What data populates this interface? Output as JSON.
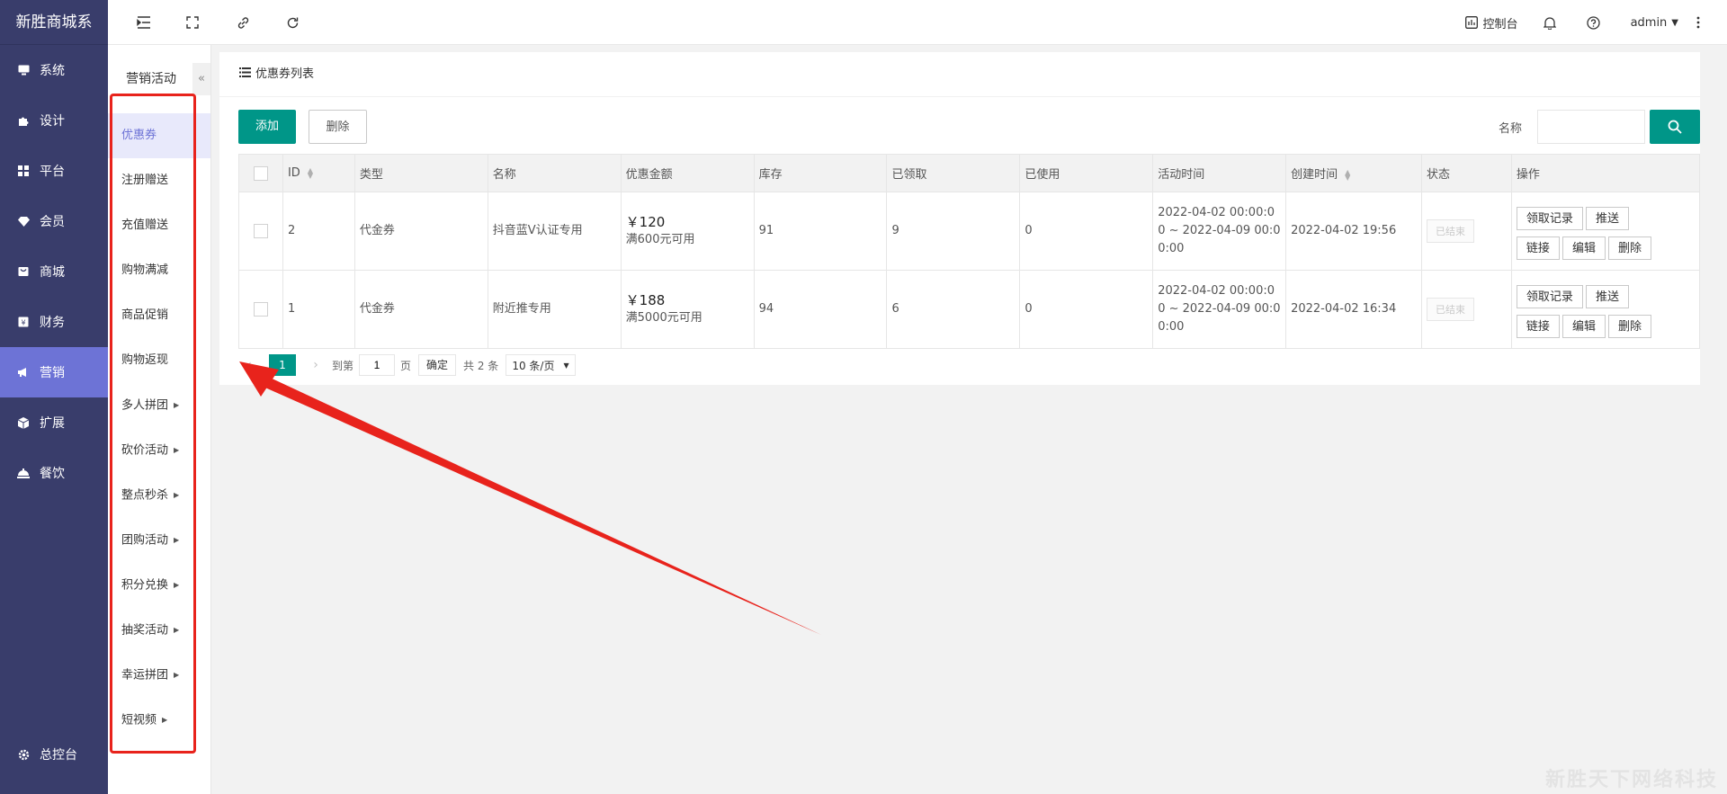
{
  "brand": "新胜商城系",
  "nav": [
    {
      "label": "系统",
      "icon": "monitor-icon"
    },
    {
      "label": "设计",
      "icon": "puzzle-icon"
    },
    {
      "label": "平台",
      "icon": "grid-icon"
    },
    {
      "label": "会员",
      "icon": "diamond-icon"
    },
    {
      "label": "商城",
      "icon": "mall-icon"
    },
    {
      "label": "财务",
      "icon": "wallet-icon"
    },
    {
      "label": "营销",
      "icon": "megaphone-icon",
      "active": true
    },
    {
      "label": "扩展",
      "icon": "cube-icon"
    },
    {
      "label": "餐饮",
      "icon": "dish-icon"
    }
  ],
  "nav_bottom": {
    "label": "总控台",
    "icon": "gear-icon"
  },
  "submenu": {
    "title": "营销活动",
    "collapse": "«",
    "items": [
      {
        "label": "优惠券",
        "active": true
      },
      {
        "label": "注册赠送"
      },
      {
        "label": "充值赠送"
      },
      {
        "label": "购物满减"
      },
      {
        "label": "商品促销"
      },
      {
        "label": "购物返现"
      },
      {
        "label": "多人拼团",
        "expand": true
      },
      {
        "label": "砍价活动",
        "expand": true
      },
      {
        "label": "整点秒杀",
        "expand": true
      },
      {
        "label": "团购活动",
        "expand": true
      },
      {
        "label": "积分兑换",
        "expand": true
      },
      {
        "label": "抽奖活动",
        "expand": true
      },
      {
        "label": "幸运拼团",
        "expand": true
      },
      {
        "label": "短视频",
        "expand": true
      }
    ]
  },
  "header": {
    "console_label": "控制台",
    "user_label": "admin"
  },
  "panel": {
    "title": "优惠券列表",
    "add_label": "添加",
    "delete_label": "删除",
    "search_label": "名称",
    "search_value": ""
  },
  "table": {
    "columns": [
      "ID",
      "类型",
      "名称",
      "优惠金额",
      "库存",
      "已领取",
      "已使用",
      "活动时间",
      "创建时间",
      "状态",
      "操作"
    ],
    "rows": [
      {
        "id": "2",
        "type": "代金券",
        "name": "抖音蓝V认证专用",
        "amount": "￥120",
        "amount_cond": "满600元可用",
        "stock": "91",
        "received": "9",
        "used": "0",
        "time": "2022-04-02 00:00:00 ~ 2022-04-09 00:00:00",
        "created": "2022-04-02 19:56",
        "status": "已结束"
      },
      {
        "id": "1",
        "type": "代金券",
        "name": "附近推专用",
        "amount": "￥188",
        "amount_cond": "满5000元可用",
        "stock": "94",
        "received": "6",
        "used": "0",
        "time": "2022-04-02 00:00:00 ~ 2022-04-09 00:00:00",
        "created": "2022-04-02 16:34",
        "status": "已结束"
      }
    ],
    "ops": {
      "record": "领取记录",
      "push": "推送",
      "link": "链接",
      "edit": "编辑",
      "delete": "删除"
    }
  },
  "pager": {
    "current": "1",
    "goto_label": "到第",
    "page_input": "1",
    "page_unit": "页",
    "confirm": "确定",
    "total": "共 2 条",
    "page_size": "10 条/页"
  },
  "watermark": "新胜天下网络科技",
  "colors": {
    "sidebar": "#393d6b",
    "active": "#6d73d6",
    "primary": "#009688",
    "annotation": "#e8231c"
  }
}
